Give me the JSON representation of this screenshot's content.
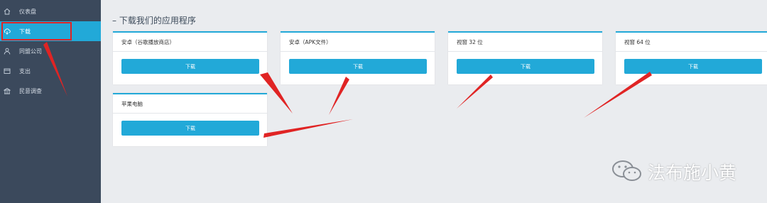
{
  "sidebar": {
    "items": [
      {
        "label": "仪表盘",
        "icon": "home-icon"
      },
      {
        "label": "下载",
        "icon": "cloud-download-icon"
      },
      {
        "label": "同盟公司",
        "icon": "user-icon"
      },
      {
        "label": "支出",
        "icon": "wallet-icon"
      },
      {
        "label": "民意调查",
        "icon": "building-icon"
      }
    ]
  },
  "main": {
    "title": "下载我们的应用程序",
    "cards": [
      {
        "title": "安卓（谷歌播放商店）",
        "button": "下载"
      },
      {
        "title": "安卓（APK文件）",
        "button": "下载"
      },
      {
        "title": "视窗 32 位",
        "button": "下载"
      },
      {
        "title": "视窗 64 位",
        "button": "下载"
      },
      {
        "title": "苹果电脑",
        "button": "下载"
      }
    ]
  },
  "watermark": {
    "text": "法布施小黄",
    "icon": "wechat-icon"
  },
  "colors": {
    "sidebar": "#3b495c",
    "accent": "#22a9d8",
    "annotation": "#e02424",
    "background": "#eaecef"
  }
}
